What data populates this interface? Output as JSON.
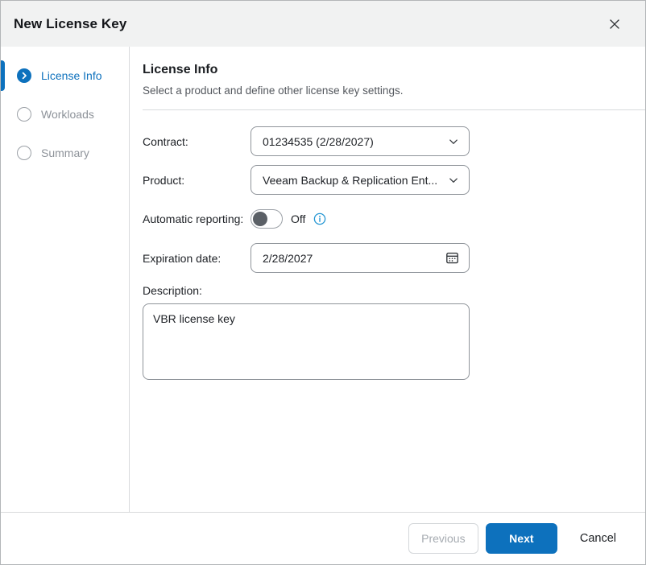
{
  "dialog": {
    "title": "New License Key",
    "close_label": "×"
  },
  "sidebar": {
    "steps": [
      {
        "label": "License Info",
        "state": "active"
      },
      {
        "label": "Workloads",
        "state": "upcoming"
      },
      {
        "label": "Summary",
        "state": "upcoming"
      }
    ]
  },
  "content": {
    "heading": "License Info",
    "subheading": "Select a product and define other license key settings.",
    "fields": {
      "contract": {
        "label": "Contract:",
        "value": "01234535 (2/28/2027)"
      },
      "product": {
        "label": "Product:",
        "value": "Veeam Backup & Replication Ent..."
      },
      "automatic_reporting": {
        "label": "Automatic reporting:",
        "state_label": "Off",
        "enabled": false
      },
      "expiration_date": {
        "label": "Expiration date:",
        "value": "2/28/2027"
      },
      "description": {
        "label": "Description:",
        "value": "VBR license key"
      }
    }
  },
  "footer": {
    "previous_label": "Previous",
    "next_label": "Next",
    "cancel_label": "Cancel"
  },
  "icons": {
    "active_step": "chevron-right-circle",
    "dropdown": "chevron-down",
    "expiration": "calendar",
    "reporting_info": "info-circle"
  },
  "colors": {
    "accent_blue": "#0d71bd",
    "info_blue": "#2496d3",
    "header_bg": "#f1f2f2",
    "border_gray": "#8f949a",
    "divider_gray": "#d8dadc",
    "muted_text": "#8e939a",
    "knob_gray": "#5b6066"
  }
}
